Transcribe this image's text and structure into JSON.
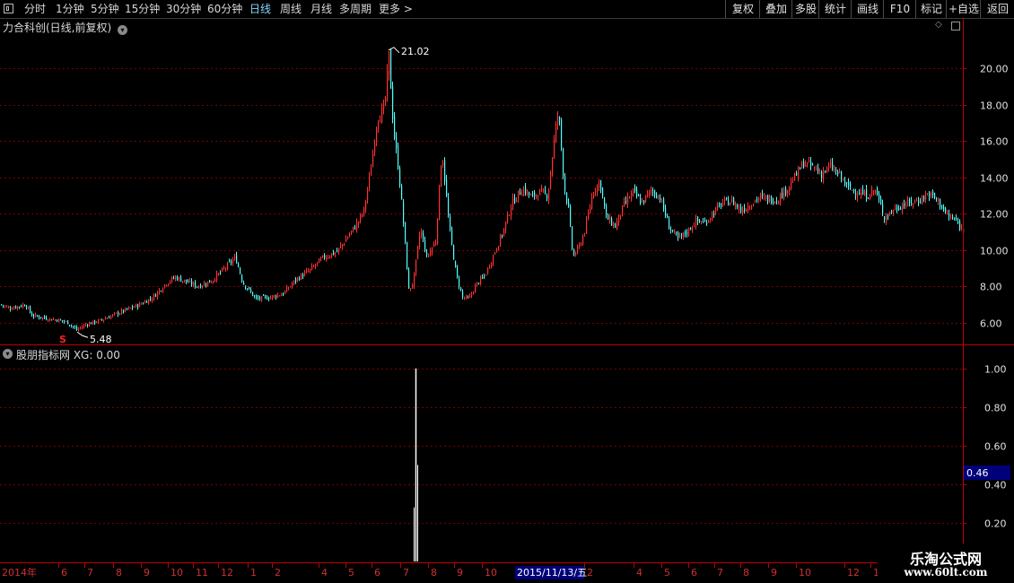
{
  "toolbar": {
    "periods": [
      {
        "label": "分时",
        "active": false
      },
      {
        "label": "1分钟",
        "active": false
      },
      {
        "label": "5分钟",
        "active": false
      },
      {
        "label": "15分钟",
        "active": false
      },
      {
        "label": "30分钟",
        "active": false
      },
      {
        "label": "60分钟",
        "active": false
      },
      {
        "label": "日线",
        "active": true
      },
      {
        "label": "周线",
        "active": false
      },
      {
        "label": "月线",
        "active": false
      },
      {
        "label": "多周期",
        "active": false
      },
      {
        "label": "更多 >",
        "active": false
      }
    ],
    "right_buttons": [
      "复权",
      "叠加",
      "多股",
      "统计",
      "画线",
      "F10",
      "标记",
      "+自选",
      "返回"
    ]
  },
  "main_panel": {
    "title": "力合科创(日线,前复权)",
    "high_label": "21.02",
    "low_label": "5.48",
    "signal_marker": "S",
    "y_ticks": [
      "20.00",
      "18.00",
      "16.00",
      "14.00",
      "12.00",
      "10.00",
      "8.00",
      "6.00"
    ]
  },
  "indicator_panel": {
    "title": "股朋指标网 XG: 0.00",
    "y_ticks": [
      "1.00",
      "0.80",
      "0.60",
      "0.40",
      "0.20"
    ],
    "cursor_value": "0.46"
  },
  "x_axis": {
    "labels": [
      "2014年",
      "6",
      "7",
      "8",
      "9",
      "10",
      "11",
      "12",
      "1",
      "2",
      "4",
      "5",
      "6",
      "7",
      "8",
      "9",
      "10",
      "2",
      "4",
      "5",
      "6",
      "7",
      "8",
      "9",
      "10",
      "12",
      "1"
    ],
    "cursor_date": "2015/11/13/五"
  },
  "watermark": {
    "line1": "乐淘公式网",
    "line2": "www.60lt.com"
  },
  "colors": {
    "up": "#ff3232",
    "down": "#54ffff",
    "grid": "#7a0000",
    "axis": "#c00000",
    "cursor_box": "#00007a"
  },
  "chart_data": {
    "type": "candlestick",
    "price_range": [
      4.8,
      21.9
    ],
    "indicator_range": [
      0,
      1.05
    ],
    "high_point": {
      "value": 21.02,
      "date": "2015/06"
    },
    "low_point": {
      "value": 5.48,
      "date": "2014/06"
    },
    "close_path": [
      [
        0,
        7.0
      ],
      [
        10,
        6.8
      ],
      [
        20,
        6.9
      ],
      [
        28,
        7.0
      ],
      [
        35,
        6.4
      ],
      [
        45,
        6.3
      ],
      [
        55,
        6.2
      ],
      [
        65,
        6.15
      ],
      [
        75,
        6.0
      ],
      [
        85,
        5.6
      ],
      [
        95,
        5.9
      ],
      [
        110,
        6.1
      ],
      [
        125,
        6.4
      ],
      [
        140,
        6.7
      ],
      [
        155,
        7.0
      ],
      [
        170,
        7.4
      ],
      [
        185,
        8.2
      ],
      [
        195,
        8.5
      ],
      [
        210,
        8.2
      ],
      [
        220,
        8.0
      ],
      [
        235,
        8.3
      ],
      [
        250,
        9.0
      ],
      [
        262,
        9.6
      ],
      [
        270,
        8.2
      ],
      [
        285,
        7.3
      ],
      [
        300,
        7.4
      ],
      [
        315,
        7.6
      ],
      [
        330,
        8.4
      ],
      [
        345,
        8.9
      ],
      [
        360,
        9.6
      ],
      [
        375,
        9.9
      ],
      [
        385,
        10.6
      ],
      [
        398,
        11.5
      ],
      [
        405,
        12.2
      ],
      [
        412,
        14.2
      ],
      [
        420,
        17.3
      ],
      [
        428,
        17.8
      ],
      [
        433,
        20.7
      ],
      [
        438,
        16.6
      ],
      [
        444,
        14.3
      ],
      [
        449,
        11.5
      ],
      [
        455,
        7.8
      ],
      [
        460,
        8.2
      ],
      [
        468,
        11.2
      ],
      [
        475,
        9.6
      ],
      [
        485,
        10.5
      ],
      [
        492,
        15.5
      ],
      [
        500,
        11.3
      ],
      [
        508,
        8.6
      ],
      [
        515,
        7.4
      ],
      [
        522,
        7.3
      ],
      [
        530,
        8.1
      ],
      [
        540,
        8.6
      ],
      [
        550,
        9.8
      ],
      [
        560,
        11.0
      ],
      [
        570,
        12.6
      ],
      [
        582,
        13.4
      ],
      [
        592,
        12.9
      ],
      [
        600,
        13.2
      ],
      [
        610,
        13.0
      ],
      [
        618,
        16.5
      ],
      [
        622,
        17.7
      ],
      [
        628,
        13.6
      ],
      [
        633,
        12.2
      ],
      [
        638,
        9.6
      ],
      [
        645,
        10.2
      ],
      [
        652,
        11.2
      ],
      [
        660,
        13.2
      ],
      [
        668,
        13.8
      ],
      [
        675,
        11.8
      ],
      [
        685,
        11.3
      ],
      [
        695,
        12.5
      ],
      [
        705,
        13.2
      ],
      [
        715,
        12.6
      ],
      [
        725,
        13.3
      ],
      [
        735,
        12.9
      ],
      [
        745,
        11.3
      ],
      [
        755,
        10.6
      ],
      [
        765,
        11.0
      ],
      [
        775,
        11.6
      ],
      [
        785,
        11.5
      ],
      [
        795,
        12.1
      ],
      [
        805,
        12.6
      ],
      [
        815,
        12.7
      ],
      [
        825,
        12.2
      ],
      [
        835,
        12.5
      ],
      [
        845,
        12.9
      ],
      [
        855,
        12.8
      ],
      [
        865,
        12.8
      ],
      [
        875,
        13.3
      ],
      [
        885,
        14.0
      ],
      [
        895,
        14.8
      ],
      [
        905,
        14.6
      ],
      [
        915,
        14.2
      ],
      [
        925,
        14.6
      ],
      [
        935,
        14.1
      ],
      [
        945,
        13.4
      ],
      [
        955,
        13.2
      ],
      [
        965,
        13.0
      ],
      [
        975,
        13.3
      ],
      [
        985,
        11.8
      ],
      [
        995,
        12.2
      ],
      [
        1005,
        12.5
      ],
      [
        1015,
        12.6
      ],
      [
        1025,
        12.8
      ],
      [
        1035,
        13.1
      ],
      [
        1045,
        12.7
      ],
      [
        1055,
        11.9
      ],
      [
        1065,
        11.6
      ],
      [
        1075,
        10.9
      ]
    ],
    "signal_index": 463,
    "signal_value": 1.0,
    "y_axis": [
      {
        "label": "20.00",
        "value": 20
      },
      {
        "label": "18.00",
        "value": 18
      },
      {
        "label": "16.00",
        "value": 16
      },
      {
        "label": "14.00",
        "value": 14
      },
      {
        "label": "12.00",
        "value": 12
      },
      {
        "label": "10.00",
        "value": 10
      },
      {
        "label": "8.00",
        "value": 8
      },
      {
        "label": "6.00",
        "value": 6
      }
    ]
  }
}
